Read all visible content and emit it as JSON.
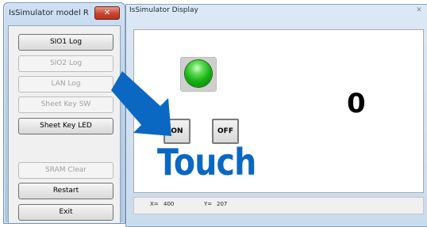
{
  "left_window": {
    "title": "IsSimulator model R",
    "close_label": "✕",
    "buttons": [
      {
        "label": "SIO1 Log",
        "enabled": true
      },
      {
        "label": "SIO2 Log",
        "enabled": false
      },
      {
        "label": "LAN Log",
        "enabled": false
      },
      {
        "label": "Sheet Key SW",
        "enabled": false
      },
      {
        "label": "Sheet Key LED",
        "enabled": true
      },
      {
        "label": "SRAM Clear",
        "enabled": false
      },
      {
        "label": "Restart",
        "enabled": true
      },
      {
        "label": "Exit",
        "enabled": true
      }
    ]
  },
  "right_window": {
    "title": "IsSimulator Display",
    "close_label": "✕",
    "display": {
      "led_state": "on",
      "led_color": "#18b016",
      "counter": "0",
      "on_label": "ON",
      "off_label": "OFF",
      "touch_label": "Touch",
      "arrow_color": "#0b68c2"
    },
    "status": {
      "x_label": "X=",
      "x_value": "400",
      "y_label": "Y=",
      "y_value": "207"
    }
  }
}
